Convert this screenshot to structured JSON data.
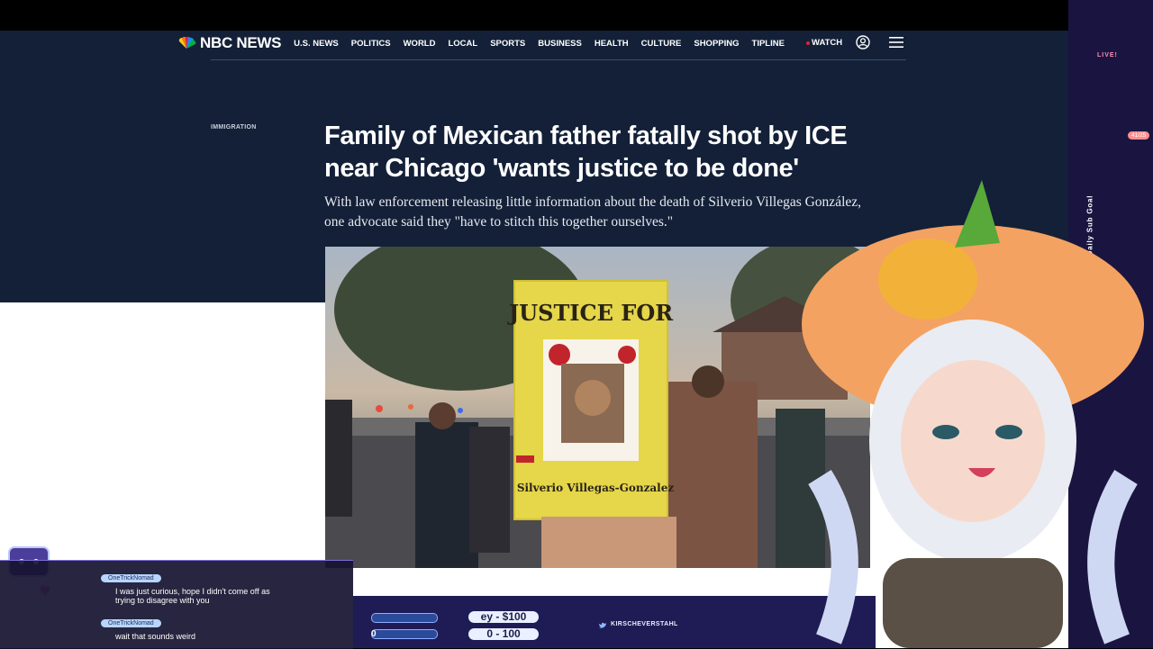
{
  "nav": {
    "brand": "NBC NEWS",
    "links": [
      "U.S. NEWS",
      "POLITICS",
      "WORLD",
      "LOCAL",
      "SPORTS",
      "BUSINESS",
      "HEALTH",
      "CULTURE",
      "SHOPPING",
      "TIPLINE"
    ],
    "watch_label": "WATCH",
    "icons": [
      "peacock-logo-icon",
      "user-icon",
      "menu-icon"
    ]
  },
  "article": {
    "section": "IMMIGRATION",
    "headline_line1": "Family of Mexican father fatally shot by ICE",
    "headline_line2": "near Chicago 'wants justice to be done'",
    "dek_line1": "With law enforcement releasing little information about the death of Silverio Villegas González,",
    "dek_line2": "one advocate said they \"have to stitch this together ourselves.\"",
    "photo": {
      "sign_title": "JUSTICE FOR",
      "sign_name": "Silverio Villegas-Gonzalez"
    }
  },
  "stream": {
    "chat": [
      {
        "user": "OneTrickNomad",
        "text_line1": "I was just curious, hope I didn't come off as",
        "text_line2": "trying to disagree with you"
      },
      {
        "user": "OneTrickNomad",
        "text_line1": "wait that sounds weird",
        "text_line2": ""
      }
    ],
    "goals": {
      "bits_goal": "ey - $100",
      "range": "0 - 100",
      "left_value": "0"
    },
    "social_handle": "KIRSCHEVERSTAHL",
    "live_label": "LIVE!",
    "sub_goal_label": "Daily Sub Goal",
    "sub_count": "41/25"
  },
  "colors": {
    "nbc_navy": "#132038",
    "accent_red": "#e0232f",
    "overlay_purple": "#1f1c55"
  }
}
